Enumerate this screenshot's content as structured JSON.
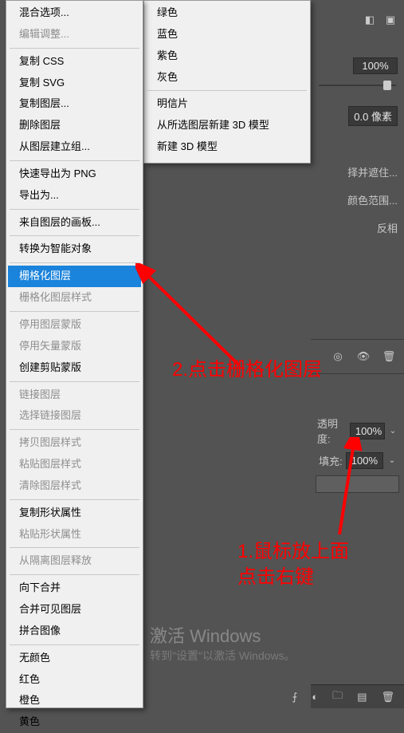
{
  "main_menu": {
    "group0": [
      "混合选项...",
      "编辑调整..."
    ],
    "group1": [
      "复制 CSS",
      "复制 SVG",
      "复制图层...",
      "删除图层",
      "从图层建立组..."
    ],
    "group2": [
      "快速导出为 PNG",
      "导出为..."
    ],
    "group3": [
      "来自图层的画板..."
    ],
    "group4": [
      "转换为智能对象"
    ],
    "group5": {
      "rasterize_layer": "栅格化图层",
      "rasterize_style": "栅格化图层样式"
    },
    "group6": [
      "停用图层蒙版",
      "停用矢量蒙版",
      "创建剪贴蒙版"
    ],
    "group7": [
      "链接图层",
      "选择链接图层"
    ],
    "group8": [
      "拷贝图层样式",
      "粘贴图层样式",
      "清除图层样式"
    ],
    "group9": [
      "复制形状属性",
      "粘贴形状属性"
    ],
    "group10": [
      "从隔离图层释放"
    ],
    "group11": [
      "向下合并",
      "合并可见图层",
      "拼合图像"
    ],
    "group12": [
      "无颜色",
      "红色",
      "橙色",
      "黄色"
    ]
  },
  "sub_menu": {
    "colors": [
      "绿色",
      "蓝色",
      "紫色",
      "灰色"
    ],
    "group2": [
      "明信片",
      "从所选图层新建 3D 模型",
      "新建 3D 模型"
    ]
  },
  "panel": {
    "opacity_val": "100%",
    "feather_label": "像素",
    "feather_val": "0.0",
    "select_mask": "择并遮住...",
    "color_range": "颜色范围...",
    "invert": "反相",
    "opacity2_label": "透明度:",
    "opacity2_val": "100%",
    "fill_label": "填充:",
    "fill_val": "100%"
  },
  "annotations": {
    "step1": "1.鼠标放上面\n点击右键",
    "step2": "2.点击栅格化图层"
  },
  "watermark": {
    "line1": "激活 Windows",
    "line2": "转到\"设置\"以激活 Windows。"
  }
}
